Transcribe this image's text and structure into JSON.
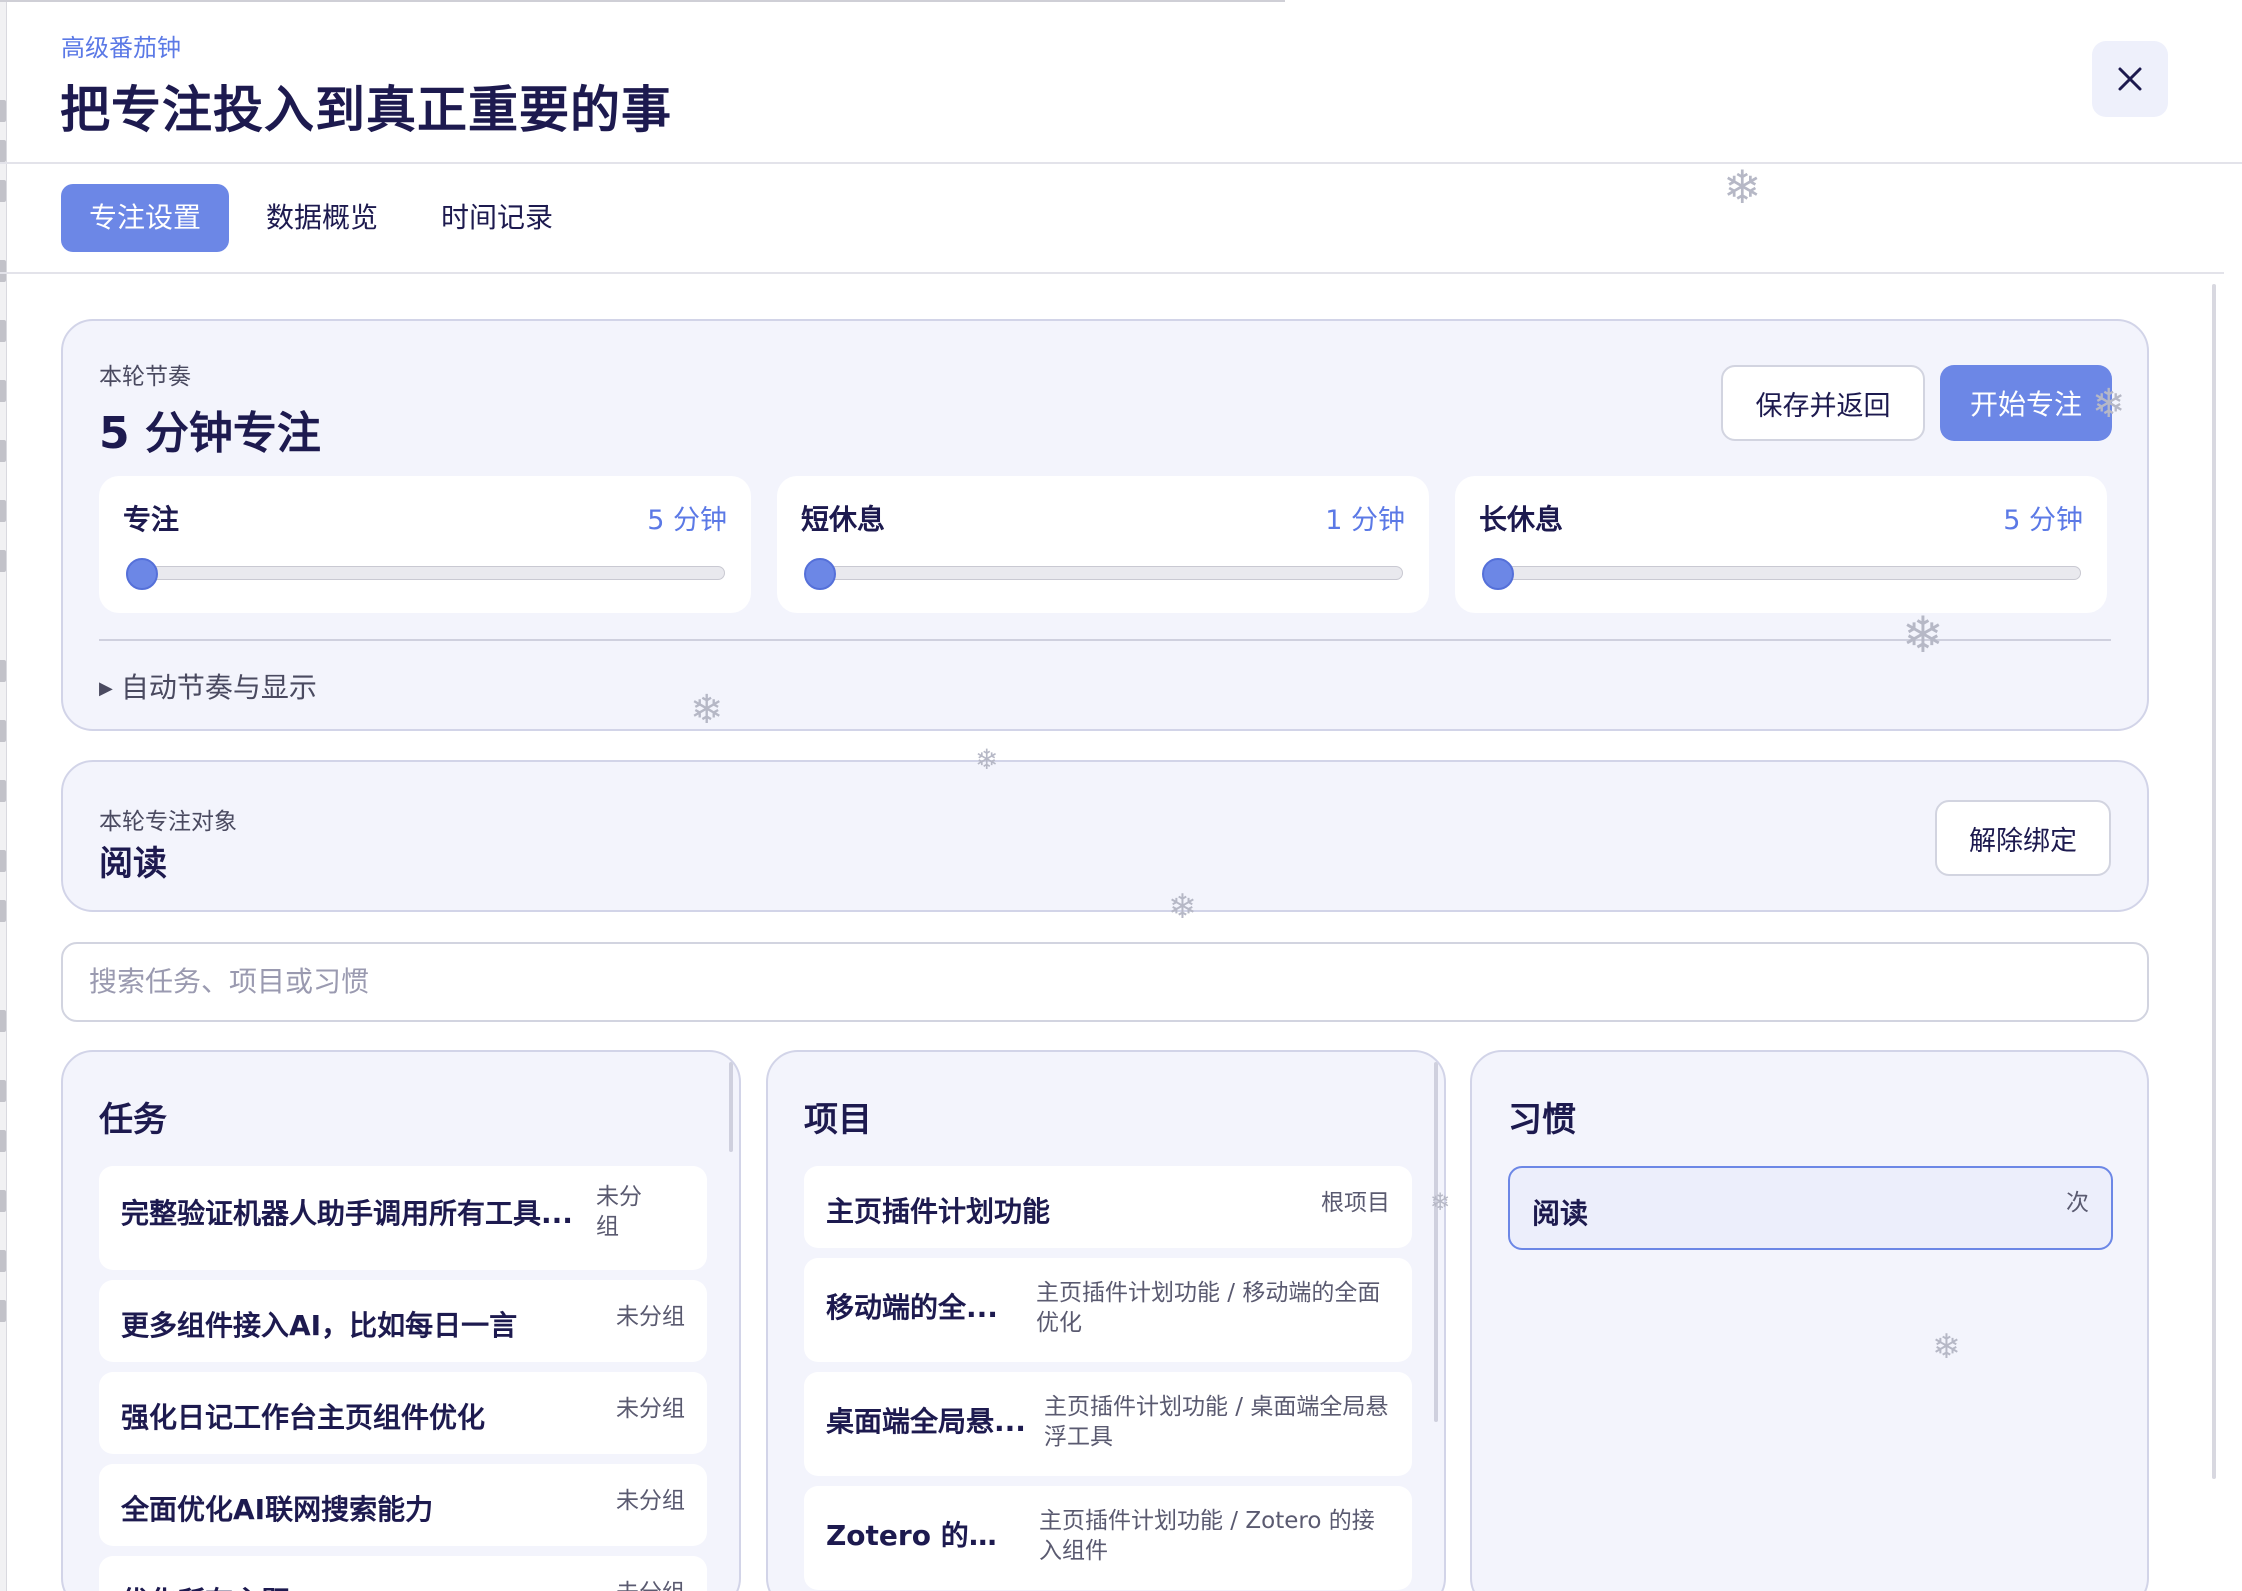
{
  "header": {
    "subtitle": "高级番茄钟",
    "title": "把专注投入到真正重要的事",
    "close_icon": "close-icon"
  },
  "tabs": [
    {
      "label": "专注设置",
      "active": true
    },
    {
      "label": "数据概览",
      "active": false
    },
    {
      "label": "时间记录",
      "active": false
    }
  ],
  "rhythm": {
    "label": "本轮节奏",
    "title": "5 分钟专注",
    "save_button": "保存并返回",
    "start_button": "开始专注",
    "sliders": [
      {
        "name": "专注",
        "value_text": "5 分钟",
        "fraction": 0.0
      },
      {
        "name": "短休息",
        "value_text": "1 分钟",
        "fraction": 0.0
      },
      {
        "name": "长休息",
        "value_text": "5 分钟",
        "fraction": 0.0
      }
    ],
    "details_summary": "自动节奏与显示"
  },
  "target": {
    "label": "本轮专注对象",
    "value": "阅读",
    "unbind_button": "解除绑定"
  },
  "search": {
    "placeholder": "搜索任务、项目或习惯"
  },
  "columns": {
    "tasks": {
      "title": "任务",
      "items": [
        {
          "name": "完整验证机器人助手调用所有工具...",
          "meta": "未分\n组"
        },
        {
          "name": "更多组件接入AI，比如每日一言",
          "meta": "未分组"
        },
        {
          "name": "强化日记工作台主页组件优化",
          "meta": "未分组"
        },
        {
          "name": "全面优化AI联网搜索能力",
          "meta": "未分组"
        },
        {
          "name": "优化所有主题",
          "meta": "未分组"
        }
      ]
    },
    "projects": {
      "title": "项目",
      "items": [
        {
          "name": "主页插件计划功能",
          "meta": "根项目"
        },
        {
          "name": "移动端的全...",
          "meta": "主页插件计划功能 / 移动端的全面优化"
        },
        {
          "name": "桌面端全局悬...",
          "meta": "主页插件计划功能 / 桌面端全局悬浮工具"
        },
        {
          "name": "Zotero 的接...",
          "meta": "主页插件计划功能 / Zotero 的接入组件"
        }
      ]
    },
    "habits": {
      "title": "习惯",
      "items": [
        {
          "name": "阅读",
          "meta": "次",
          "selected": true
        }
      ]
    }
  },
  "colors": {
    "accent": "#6c87e6",
    "title": "#1d1a4f",
    "card_bg": "#f3f4fc"
  }
}
